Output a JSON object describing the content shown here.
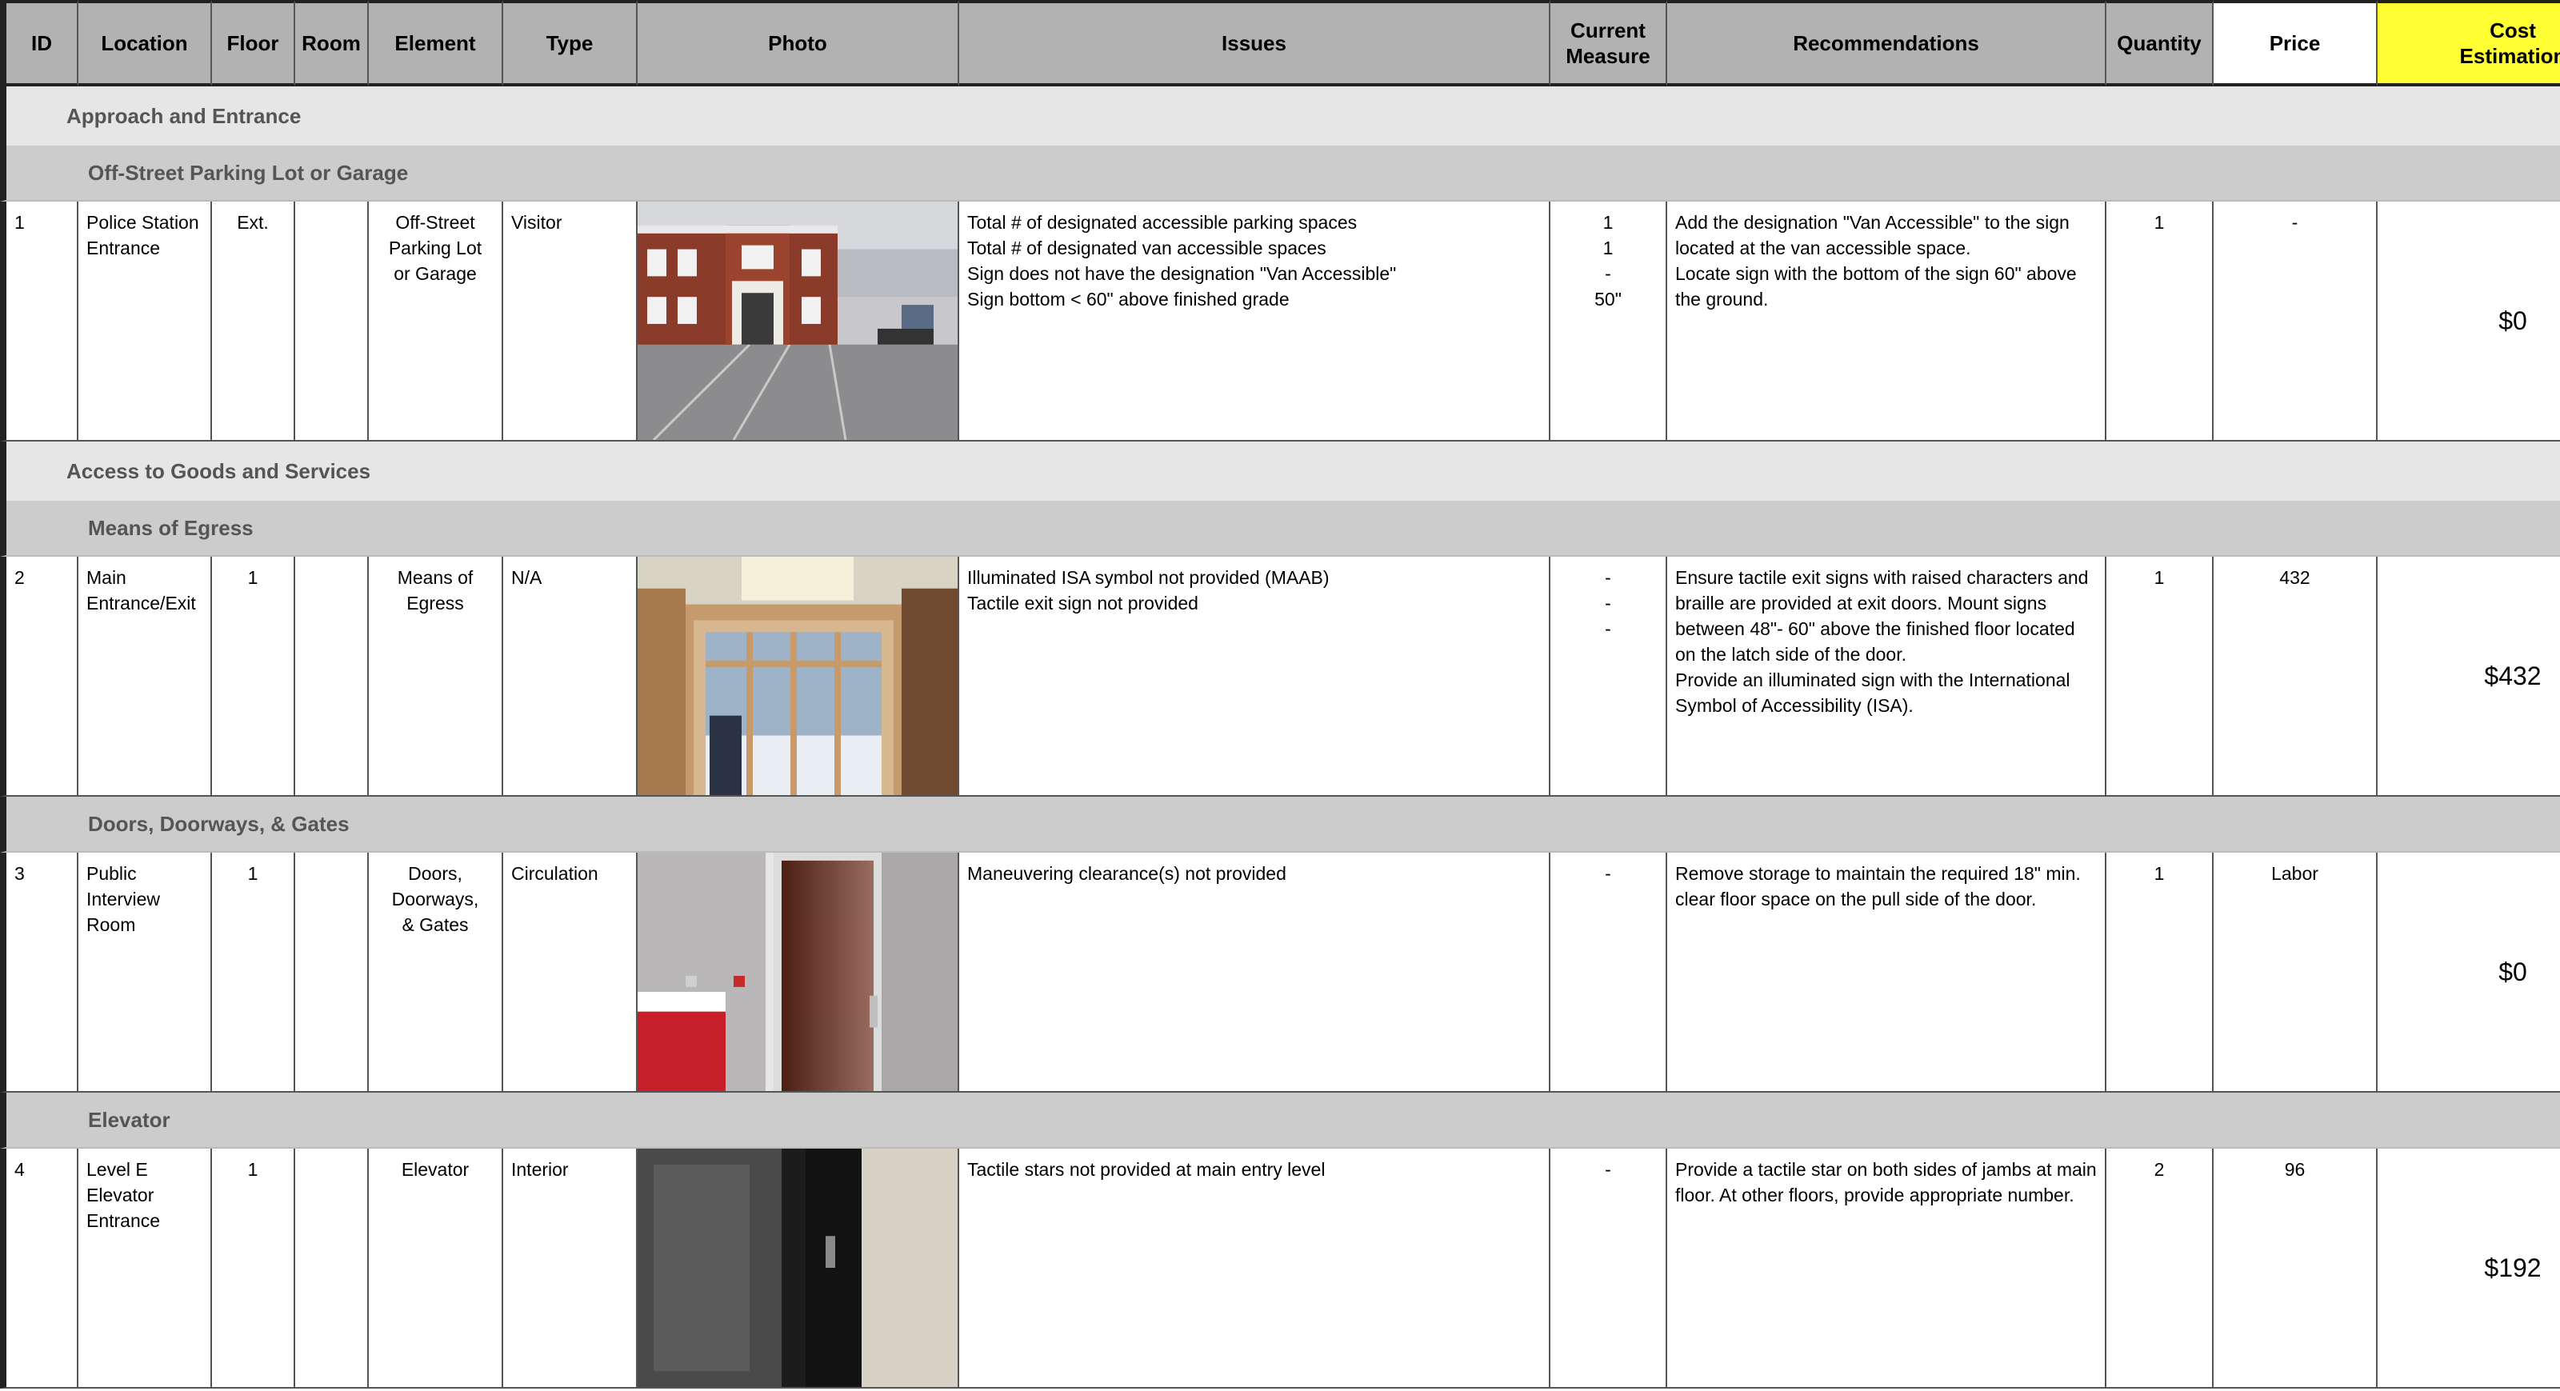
{
  "columns": {
    "id": "ID",
    "location": "Location",
    "floor": "Floor",
    "room": "Room",
    "element": "Element",
    "type": "Type",
    "photo": "Photo",
    "issues": "Issues",
    "current_measure": "Current\nMeasure",
    "recommendations": "Recommendations",
    "quantity": "Quantity",
    "price": "Price",
    "cost": "Cost\nEstimation"
  },
  "colors": {
    "header_bg": "#b2b2b2",
    "cost_header_bg": "#ffff33",
    "section_bg": "#e6e6e6",
    "subsection_bg": "#cccccc"
  },
  "sections": [
    {
      "title": "Approach and Entrance",
      "subsections": [
        {
          "title": "Off-Street Parking Lot or Garage",
          "rows": [
            {
              "id": "1",
              "location": "Police Station\nEntrance",
              "floor": "Ext.",
              "room": "",
              "element": "Off-Street\nParking Lot\nor Garage",
              "type": "Visitor",
              "photo": "building-exterior-parking-lot-photo",
              "issues": "Total # of designated accessible parking spaces\nTotal # of designated van accessible spaces\nSign does not have the designation \"Van Accessible\"\nSign bottom < 60\" above finished grade",
              "measure": "1\n1\n-\n50\"",
              "recommendations": "Add the designation \"Van Accessible\" to the sign located at the van accessible space.\nLocate sign with the bottom of the sign 60\" above the ground.",
              "quantity": "1",
              "price": "-",
              "cost": "$0"
            }
          ]
        }
      ]
    },
    {
      "title": "Access to Goods and Services",
      "subsections": [
        {
          "title": "Means of Egress",
          "rows": [
            {
              "id": "2",
              "location": "Main\nEntrance/Exit",
              "floor": "1",
              "room": "",
              "element": "Means of\nEgress",
              "type": "N/A",
              "photo": "entrance-doors-photo",
              "issues": "Illuminated ISA symbol not provided (MAAB)\nTactile exit sign not provided",
              "measure": "-\n-\n-",
              "recommendations": "Ensure tactile exit signs with raised characters and braille are provided at exit doors. Mount signs between 48\"- 60\" above the finished floor located on the latch side of the door.\nProvide an illuminated sign with the International Symbol of Accessibility (ISA).",
              "quantity": "1",
              "price": "432",
              "cost": "$432"
            }
          ]
        },
        {
          "title": "Doors, Doorways, & Gates",
          "rows": [
            {
              "id": "3",
              "location": "Public\nInterview\nRoom",
              "floor": "1",
              "room": "",
              "element": "Doors,\nDoorways,\n& Gates",
              "type": "Circulation",
              "photo": "wooden-door-cooler-photo",
              "issues": "Maneuvering clearance(s) not provided",
              "measure": "-",
              "recommendations": "Remove storage to maintain the required 18\" min. clear floor space on the pull side of the door.",
              "quantity": "1",
              "price": "Labor",
              "cost": "$0"
            }
          ]
        },
        {
          "title": "Elevator",
          "rows": [
            {
              "id": "4",
              "location": "Level E\nElevator\nEntrance",
              "floor": "1",
              "room": "",
              "element": "Elevator",
              "type": "Interior",
              "photo": "elevator-jamb-photo",
              "issues": "Tactile stars not provided at main entry level",
              "measure": "-",
              "recommendations": "Provide a tactile star on both sides of jambs at main floor. At other floors, provide appropriate number.",
              "quantity": "2",
              "price": "96",
              "cost": "$192"
            }
          ]
        }
      ]
    }
  ]
}
